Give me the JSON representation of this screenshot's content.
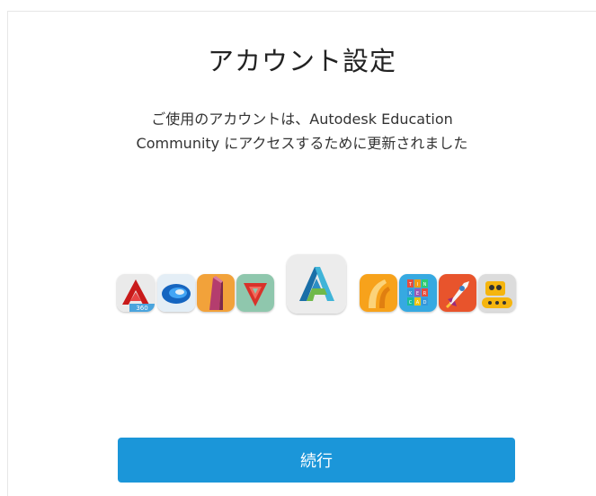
{
  "dialog": {
    "title": "アカウント設定",
    "message_line1": "ご使用のアカウントは、Autodesk Education",
    "message_line2": "Community にアクセスするために更新されました"
  },
  "icons": [
    {
      "name": "autocad-360-icon",
      "label": "360"
    },
    {
      "name": "autodesk-swirl-app-icon"
    },
    {
      "name": "formit-app-icon"
    },
    {
      "name": "123d-make-app-icon"
    },
    {
      "name": "autodesk-a-logo-icon"
    },
    {
      "name": "sketchbook-app-icon"
    },
    {
      "name": "tinkercad-app-icon",
      "letters": [
        "T",
        "I",
        "N",
        "K",
        "E",
        "R",
        "C",
        "A",
        "D"
      ]
    },
    {
      "name": "rocket-app-icon"
    },
    {
      "name": "robot-app-icon"
    }
  ],
  "colors": {
    "primary_button": "#1b96d9",
    "title_text": "#222222"
  },
  "actions": {
    "continue_label": "続行"
  }
}
